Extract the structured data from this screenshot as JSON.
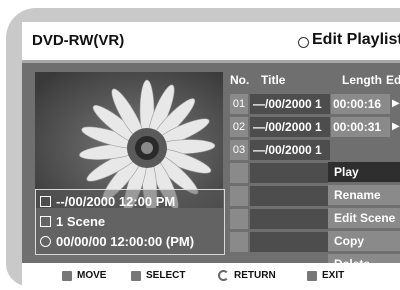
{
  "header": {
    "left_title": "DVD-RW(VR)",
    "right_title": "Edit Playlist"
  },
  "columns": {
    "no": "No.",
    "title": "Title",
    "length": "Length",
    "edit": "Edit"
  },
  "rows": [
    {
      "no": "01",
      "title": "—/00/2000 1",
      "length": "00:00:16",
      "arrow": "▶"
    },
    {
      "no": "02",
      "title": "—/00/2000 1",
      "length": "00:00:31",
      "arrow": "▶"
    },
    {
      "no": "03",
      "title": "—/00/2000 1",
      "length": "",
      "arrow": ""
    }
  ],
  "menu": [
    "Play",
    "Rename",
    "Edit Scene",
    "Copy",
    "Delete"
  ],
  "info": {
    "date": "--/00/2000 12:00 PM",
    "scenes": "1 Scene",
    "time": "00/00/00 12:00:00 (PM)"
  },
  "footer": {
    "move": "MOVE",
    "select": "SELECT",
    "return": "RETURN",
    "exit": "EXIT"
  }
}
